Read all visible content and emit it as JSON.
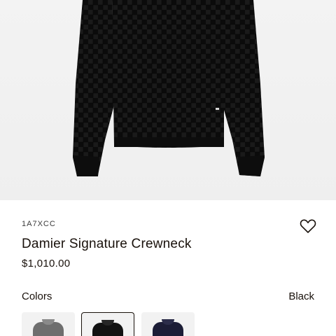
{
  "product": {
    "sku": "1A7XCC",
    "title": "Damier Signature Crewneck",
    "price": "$1,010.00"
  },
  "colors": {
    "label": "Colors",
    "selected": "Black",
    "swatches": [
      {
        "color": "#6e6e6e",
        "selected": false
      },
      {
        "color": "#121212",
        "selected": true
      },
      {
        "color": "#1c1d36",
        "selected": false
      }
    ]
  },
  "icons": {
    "wishlist": "heart-outline-icon"
  },
  "theme": {
    "text": "#19110b",
    "hero_bg": "#f0f0f0",
    "garment": "#0e0e0e"
  }
}
